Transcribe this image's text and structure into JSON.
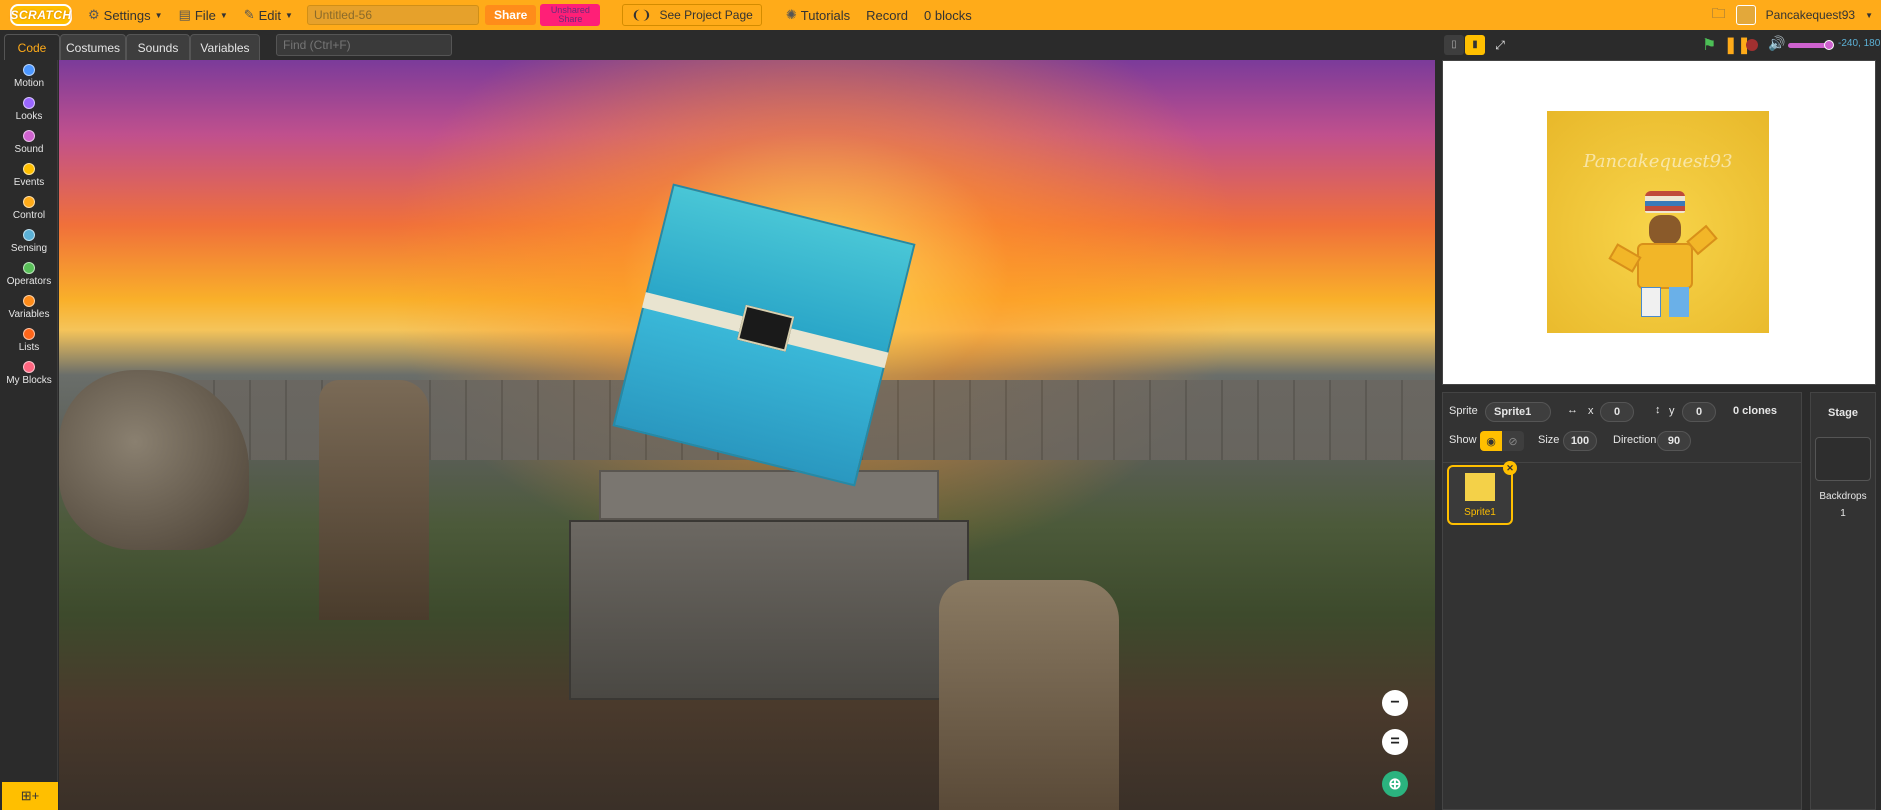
{
  "menubar": {
    "logo": "SCRATCH",
    "settings": "Settings",
    "file": "File",
    "edit": "Edit",
    "project_title": "Untitled-56",
    "share": "Share",
    "pink_button": "Unshared Share",
    "see_project_page": "See Project Page",
    "tutorials": "Tutorials",
    "record": "Record",
    "blocks_count": "0 blocks",
    "username": "Pancakequest93"
  },
  "editor_tabs": [
    "Code",
    "Costumes",
    "Sounds",
    "Variables"
  ],
  "find_placeholder": "Find (Ctrl+F)",
  "categories": [
    {
      "label": "Motion",
      "color": "#4c97ff"
    },
    {
      "label": "Looks",
      "color": "#9966ff"
    },
    {
      "label": "Sound",
      "color": "#cf63cf"
    },
    {
      "label": "Events",
      "color": "#ffbf00"
    },
    {
      "label": "Control",
      "color": "#ffab19"
    },
    {
      "label": "Sensing",
      "color": "#5cb1d6"
    },
    {
      "label": "Operators",
      "color": "#59c059"
    },
    {
      "label": "Variables",
      "color": "#ff8c1a"
    },
    {
      "label": "Lists",
      "color": "#ff661a"
    },
    {
      "label": "My Blocks",
      "color": "#ff6680"
    }
  ],
  "stage_header": {
    "coords": "-240, 180"
  },
  "stage": {
    "watermark": "Pancakequest93"
  },
  "sprite_info": {
    "sprite_label": "Sprite",
    "sprite_name": "Sprite1",
    "x_label": "x",
    "x_value": "0",
    "y_label": "y",
    "y_value": "0",
    "clones": "0 clones",
    "show_label": "Show",
    "size_label": "Size",
    "size_value": "100",
    "direction_label": "Direction",
    "direction_value": "90"
  },
  "sprites": [
    {
      "name": "Sprite1"
    }
  ],
  "stage_pane": {
    "title": "Stage",
    "backdrops_label": "Backdrops",
    "backdrops_count": "1"
  }
}
